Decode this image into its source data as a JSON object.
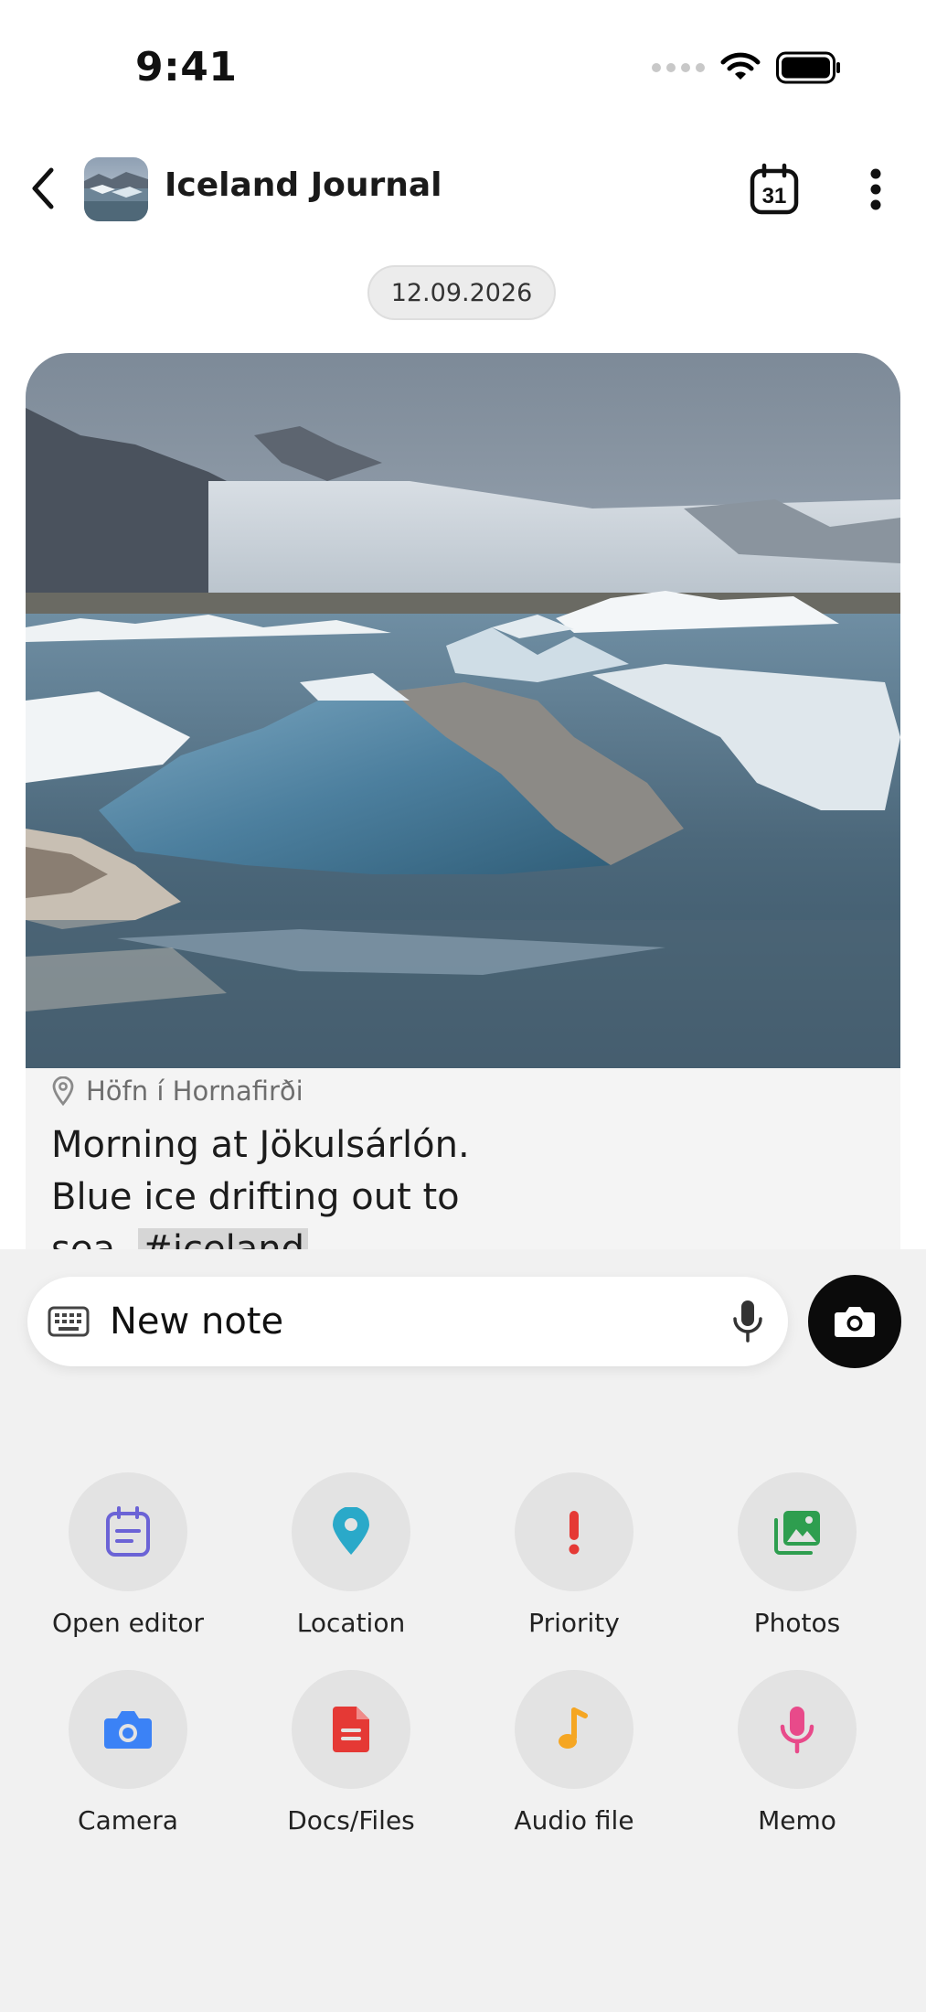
{
  "status_bar": {
    "time": "9:41"
  },
  "header": {
    "title": "Iceland Journal",
    "calendar_day": "31"
  },
  "date_separator": "12.09.2026",
  "note": {
    "location": "Höfn í Hornafirði",
    "line1": "Morning at Jökulsárlón.",
    "line2": "Blue ice drifting out to",
    "line3_prefix": "sea. ",
    "hashtag": "#iceland"
  },
  "composer": {
    "placeholder": "New note"
  },
  "actions": [
    {
      "label": "Open editor",
      "icon": "editor-icon",
      "color": "#6b63d6"
    },
    {
      "label": "Location",
      "icon": "location-pin-icon",
      "color": "#2aa9c9"
    },
    {
      "label": "Priority",
      "icon": "exclamation-icon",
      "color": "#e53935"
    },
    {
      "label": "Photos",
      "icon": "photos-icon",
      "color": "#2e9e4f"
    },
    {
      "label": "Camera",
      "icon": "camera-icon",
      "color": "#3b82f6"
    },
    {
      "label": "Docs/Files",
      "icon": "document-icon",
      "color": "#e53935"
    },
    {
      "label": "Audio file",
      "icon": "music-note-icon",
      "color": "#f5a623"
    },
    {
      "label": "Memo",
      "icon": "microphone-icon",
      "color": "#e84a8a"
    }
  ]
}
